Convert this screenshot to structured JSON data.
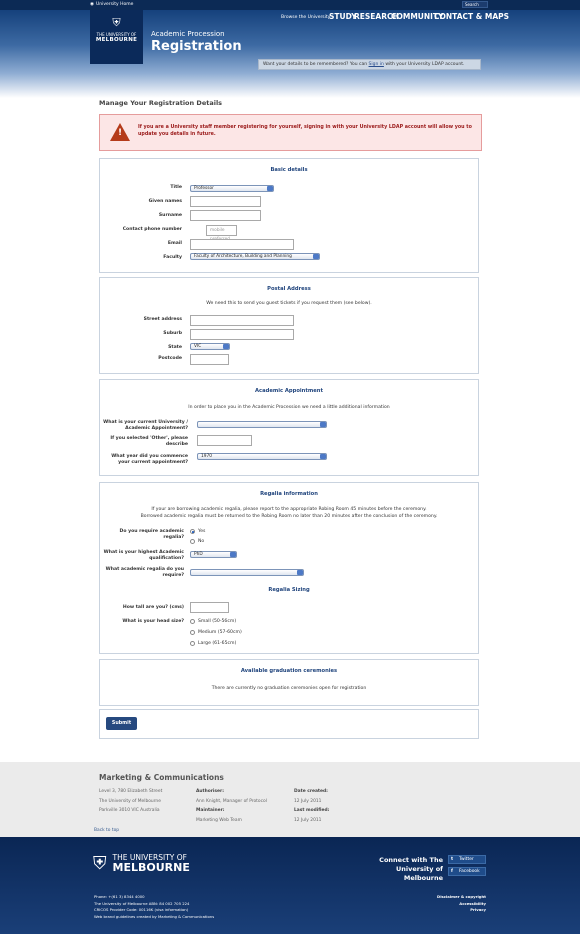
{
  "topbar": {
    "home_link": "University Home",
    "search_placeholder": "Search"
  },
  "header": {
    "crest_line1": "THE UNIVERSITY OF",
    "crest_line2": "MELBOURNE",
    "browse": "Browse the University",
    "nav": [
      "STUDY",
      "RESEARCH",
      "COMMUNITY",
      "CONTACT & MAPS"
    ],
    "subtitle": "Academic Procession",
    "title": "Registration",
    "remember_pre": "Want your details to be remembered? You can ",
    "remember_link": "Sign in",
    "remember_post": " with your University LDAP account."
  },
  "main": {
    "page_title": "Manage Your Registration Details",
    "warning": "If you are a University staff member registering for yourself, signing in with your University LDAP account will allow you to update you details in future."
  },
  "basic": {
    "heading": "Basic details",
    "title_label": "Title",
    "title_value": "Professor",
    "given_label": "Given names",
    "surname_label": "Surname",
    "phone_label": "Contact phone number",
    "phone_placeholder": "mobile preferred",
    "email_label": "Email",
    "faculty_label": "Faculty",
    "faculty_value": "Faculty of Architecture, Building and Planning"
  },
  "postal": {
    "heading": "Postal Address",
    "intro": "We need this to send you guest tickets if you request them (see below).",
    "street_label": "Street address",
    "suburb_label": "Suburb",
    "state_label": "State",
    "state_value": "VIC",
    "postcode_label": "Postcode"
  },
  "appointment": {
    "heading": "Academic Appointment",
    "intro": "In order to place you in the Academic Procession we need a little additional information",
    "current_label_1": "What is your current University /",
    "current_label_2": "Academic Appointment?",
    "other_label_1": "If you selected 'Other', please",
    "other_label_2": "describe",
    "year_label_1": "What year did you commence",
    "year_label_2": "your current appointment?",
    "year_value": "1970"
  },
  "regalia": {
    "heading": "Regalia information",
    "intro_1": "If your are borrowing academic regalia, please report to the appropriate Robing Room 45 minutes before the ceremony.",
    "intro_2": "Borrowed academic regalia must be returned to the Robing Room no later than 20 minutes after the conclusion of the ceremony.",
    "require_label_1": "Do you require academic",
    "require_label_2": "regalia?",
    "yes": "Yes",
    "no": "No",
    "qual_label_1": "What is your highest Academic",
    "qual_label_2": "qualification?",
    "qual_value": "PhD",
    "which_label_1": "What academic regalia do you",
    "which_label_2": "require?",
    "sizing_heading": "Regalia Sizing",
    "height_label": "How tall are you? (cms)",
    "head_label": "What is your head size?",
    "sizes": [
      "Small (50-56cm)",
      "Medium (57-60cm)",
      "Large (61-65cm)"
    ]
  },
  "ceremonies": {
    "heading": "Available graduation ceremonies",
    "text": "There are currently no graduation ceremonies open for registration"
  },
  "submit_label": "Submit",
  "footer": {
    "dept": "Marketing & Communications",
    "address": [
      "Level 3, 780 Elizabeth Street",
      "The University of Melbourne",
      "Parkville 3010 VIC Australia"
    ],
    "authoriser_label": "Authoriser:",
    "authoriser": "Ann Knight, Manager of Protocol",
    "maintainer_label": "Maintainer:",
    "maintainer": "Marketing Web Team",
    "created_label": "Date created:",
    "created": "12 July 2011",
    "modified_label": "Last modified:",
    "modified": "12 July 2011",
    "back_to_top": "Back to top",
    "logo_line1": "THE UNIVERSITY OF",
    "logo_line2": "MELBOURNE",
    "connect_1": "Connect with The",
    "connect_2": "University of Melbourne",
    "twitter": "Twitter",
    "facebook": "Facebook",
    "legal": [
      "Phone: +(61 3) 8344 4000",
      "The University of Melbourne ABN: 84 002 705 224",
      "CRICOS Provider Code: 00116K (visa information)",
      "Web brand guidelines created by Marketing & Communications"
    ],
    "links": [
      "Disclaimer & copyright",
      "Accessibility",
      "Privacy"
    ]
  }
}
